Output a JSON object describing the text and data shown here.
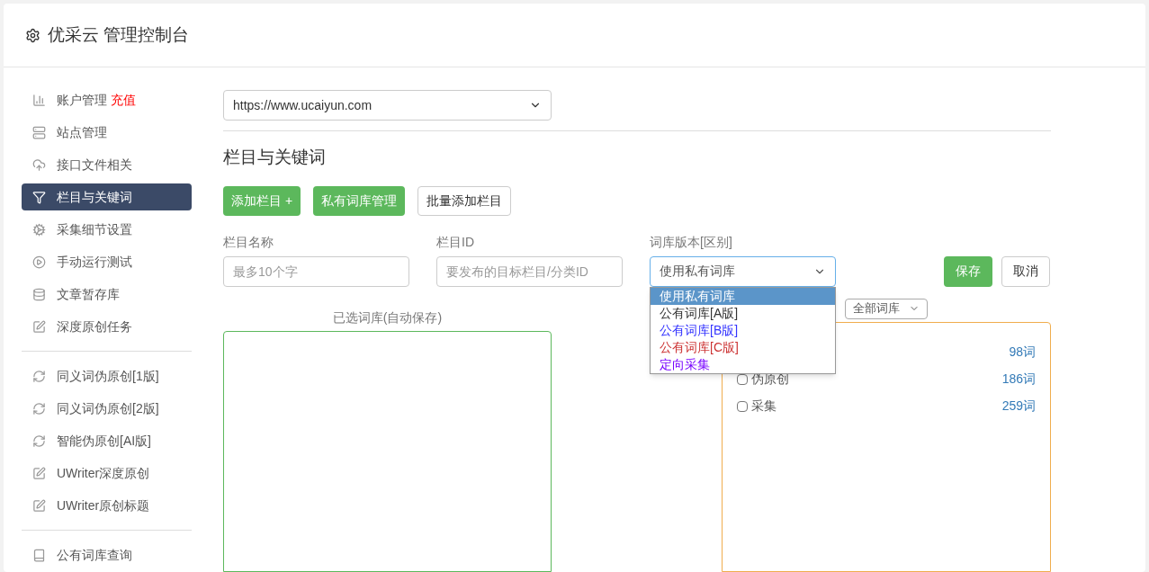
{
  "header": {
    "title": "优采云 管理控制台"
  },
  "sidebar": {
    "groups": [
      {
        "items": [
          {
            "label": "账户管理",
            "badge": "充值",
            "selected": false
          },
          {
            "label": "站点管理",
            "selected": false
          },
          {
            "label": "接口文件相关",
            "selected": false
          },
          {
            "label": "栏目与关键词",
            "selected": true
          },
          {
            "label": "采集细节设置",
            "selected": false
          },
          {
            "label": "手动运行测试",
            "selected": false
          },
          {
            "label": "文章暂存库",
            "selected": false
          },
          {
            "label": "深度原创任务",
            "selected": false
          }
        ]
      },
      {
        "items": [
          {
            "label": "同义词伪原创[1版]",
            "selected": false
          },
          {
            "label": "同义词伪原创[2版]",
            "selected": false
          },
          {
            "label": "智能伪原创[AI版]",
            "selected": false
          },
          {
            "label": "UWriter深度原创",
            "selected": false
          },
          {
            "label": "UWriter原创标题",
            "selected": false
          }
        ]
      },
      {
        "items": [
          {
            "label": "公有词库查询",
            "selected": false
          }
        ]
      }
    ]
  },
  "site_select": {
    "value": "https://www.ucaiyun.com"
  },
  "section_title": "栏目与关键词",
  "toolbar": [
    {
      "label": "添加栏目 +",
      "kind": "primary"
    },
    {
      "label": "私有词库管理",
      "kind": "primary"
    },
    {
      "label": "批量添加栏目",
      "kind": "default"
    }
  ],
  "form": {
    "fields": [
      {
        "label": "栏目名称",
        "placeholder": "最多10个字"
      },
      {
        "label": "栏目ID",
        "placeholder": "要发布的目标栏目/分类ID"
      }
    ],
    "library_select": {
      "label": "词库版本[区别]",
      "value": "使用私有词库",
      "expanded": true,
      "options": [
        {
          "label": "使用私有词库",
          "selected": true
        },
        {
          "label": "公有词库[A版]",
          "selected": false,
          "color": "#333333"
        },
        {
          "label": "公有词库[B版]",
          "selected": false,
          "color": "#3333ff"
        },
        {
          "label": "公有词库[C版]",
          "selected": false,
          "color": "#cc3333"
        },
        {
          "label": "定向采集",
          "selected": false,
          "color": "#7700ff"
        }
      ]
    },
    "save": "保存",
    "cancel": "取消"
  },
  "selected_panel": {
    "label": "已选词库(自动保存)"
  },
  "library_panel": {
    "filter": "全部词库",
    "items": [
      {
        "count": "98词"
      },
      {
        "label": "伪原创",
        "count": "186词",
        "checked": false
      },
      {
        "label": "采集",
        "count": "259词",
        "checked": false
      }
    ]
  }
}
